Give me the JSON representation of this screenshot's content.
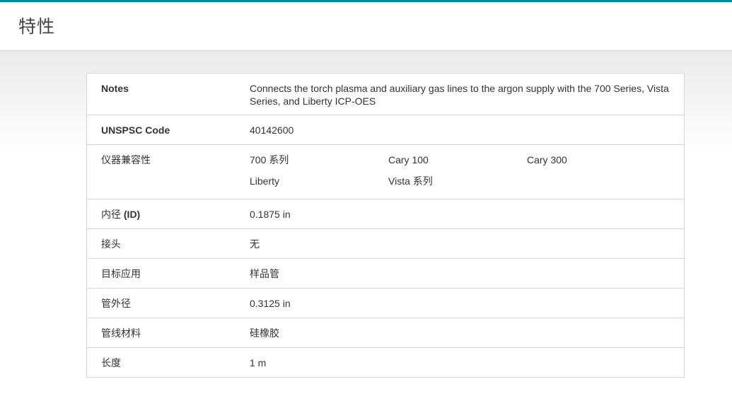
{
  "header": {
    "title": "特性"
  },
  "specs": {
    "notes": {
      "label": "Notes",
      "value": "Connects the torch plasma and auxiliary gas lines to the argon supply with the 700 Series, Vista Series, and Liberty ICP-OES"
    },
    "unspsc": {
      "label": "UNSPSC Code",
      "value": "40142600"
    },
    "compatibility": {
      "label": "仪器兼容性",
      "items": [
        "700 系列",
        "Cary 100",
        "Cary 300",
        "Liberty",
        "Vista 系列"
      ]
    },
    "inner_diameter": {
      "label_prefix": "内径 ",
      "label_bold": "(ID)",
      "value": "0.1875 in"
    },
    "connector": {
      "label": "接头",
      "value": "无"
    },
    "target_application": {
      "label": "目标应用",
      "value": "样品管"
    },
    "tube_outer_diameter": {
      "label": "管外径",
      "value": "0.3125 in"
    },
    "tube_material": {
      "label": "管线材料",
      "value": "硅橡胶"
    },
    "length": {
      "label": "长度",
      "value": "1 m"
    }
  },
  "colors": {
    "accent": "#0085a6",
    "border": "#d6d6d6",
    "text": "#333333"
  }
}
